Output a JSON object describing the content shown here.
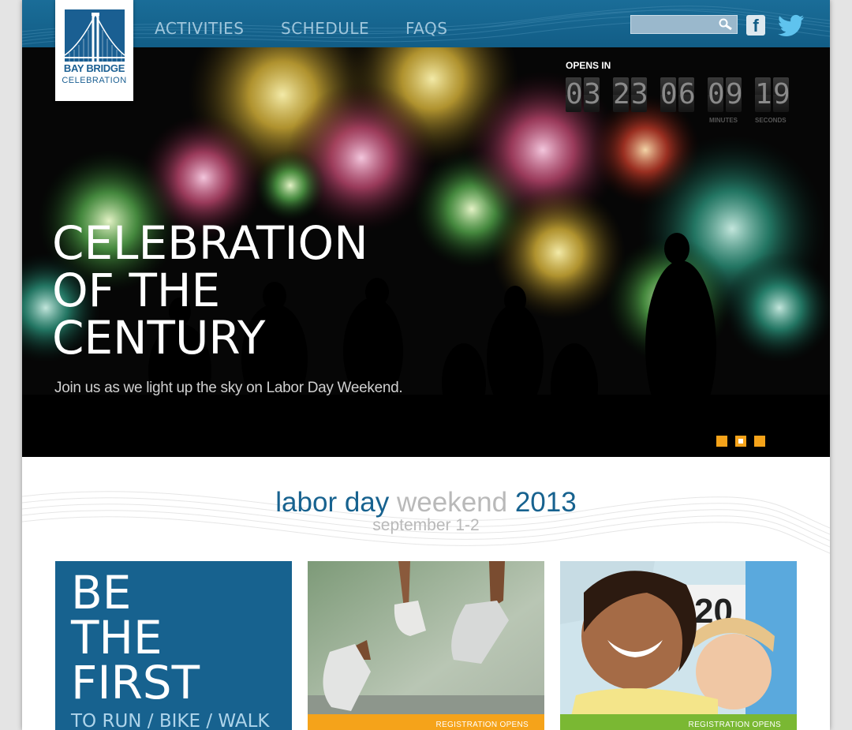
{
  "logo": {
    "line1": "BAY BRIDGE",
    "line2": "CELEBRATION"
  },
  "nav": {
    "items": [
      {
        "label": "ACTIVITIES"
      },
      {
        "label": "SCHEDULE"
      },
      {
        "label": "FAQS"
      }
    ]
  },
  "search": {
    "value": "",
    "placeholder": ""
  },
  "social": {
    "facebook_glyph": "f",
    "icons": [
      "facebook-icon",
      "twitter-icon"
    ]
  },
  "countdown": {
    "label": "OPENS IN",
    "digits": [
      "0",
      "3",
      "2",
      "3",
      "0",
      "6",
      "0",
      "9",
      "1",
      "9"
    ],
    "units": [
      "MINUTES",
      "SECONDS"
    ]
  },
  "hero": {
    "title_lines": [
      "CELEBRATION",
      "OF THE",
      "CENTURY"
    ],
    "subtitle": "Join us as we light up the sky on Labor Day Weekend.",
    "slides": {
      "count": 3,
      "active_index": 1
    }
  },
  "event": {
    "part1": "labor day",
    "part2": "weekend",
    "part3": "2013",
    "dates": "september 1-2"
  },
  "cards": [
    {
      "lines": [
        "BE",
        "THE",
        "FIRST"
      ],
      "sub": "TO RUN / BIKE / WALK"
    },
    {
      "banner": "REGISTRATION OPENS"
    },
    {
      "banner": "REGISTRATION OPENS"
    }
  ],
  "colors": {
    "brand_blue": "#17628f",
    "accent_orange": "#f5a31a",
    "accent_green": "#7ab833",
    "muted_gray": "#b9b9b9"
  }
}
